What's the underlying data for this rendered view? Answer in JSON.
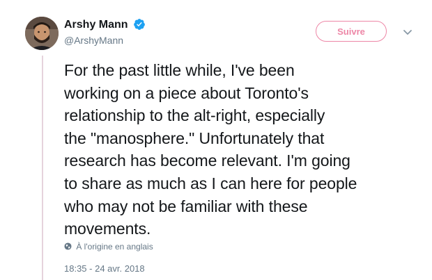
{
  "author": {
    "display_name": "Arshy Mann",
    "handle": "@ArshyMann",
    "verified": true,
    "avatar_icon": "avatar-photo"
  },
  "follow_button": {
    "label": "Suivre",
    "color": "#e0245e"
  },
  "menu_icon": "chevron-down-icon",
  "tweet": {
    "lines": [
      "For the past little while, I've been",
      "working on a piece about Toronto's",
      "relationship to the alt-right, especially",
      "the \"manosphere.\" Unfortunately that",
      "research has become relevant. I'm going",
      "to share as much as I can here for people",
      "who may not be familiar with these",
      "movements."
    ]
  },
  "translation": {
    "icon": "globe-icon",
    "label": "À l'origine en anglais"
  },
  "timestamp": "18:35 - 24 avr. 2018",
  "colors": {
    "text_primary": "#14171a",
    "text_secondary": "#657786",
    "verified_blue": "#1da1f2",
    "thread_line": "#e6d3dc"
  }
}
